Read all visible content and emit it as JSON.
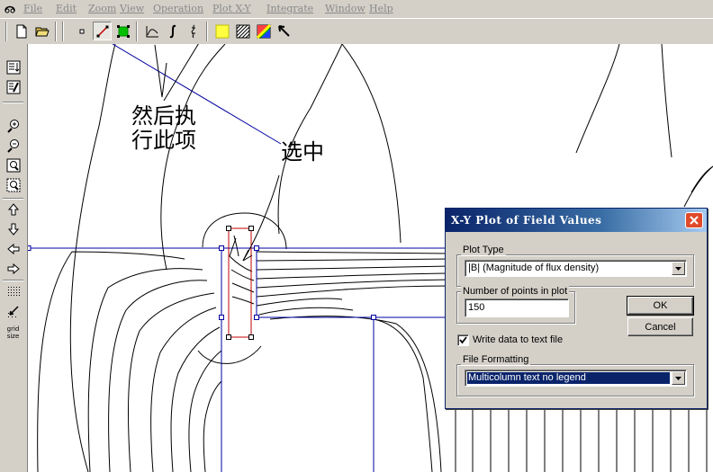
{
  "menubar": {
    "items": [
      "File",
      "Edit",
      "Zoom",
      "View",
      "Operation",
      "Plot X-Y",
      "Integrate",
      "Window",
      "Help"
    ]
  },
  "toolbar": {
    "buttons": [
      "new-file",
      "open-file",
      "point-mode",
      "contour-mode",
      "area-mode",
      "plot-xy",
      "integrate",
      "line-integral",
      "show-density",
      "show-vectors",
      "greyscale",
      "color-map",
      "select-pointer"
    ]
  },
  "annotations": {
    "line1": "然后执",
    "line2": "行此项",
    "select_label": "选中"
  },
  "left_toolbar": {
    "grid_label_1": "grid",
    "grid_label_2": "size"
  },
  "dialog": {
    "title": "X-Y Plot of Field Values",
    "plot_type_label": "Plot Type",
    "plot_type_value": "|B|      (Magnitude of flux density)",
    "points_label": "Number of points in plot",
    "points_value": "150",
    "ok_label": "OK",
    "cancel_label": "Cancel",
    "write_checkbox_label": "Write  data to text file",
    "write_checked": true,
    "file_formatting_label": "File Formatting",
    "file_formatting_value": "Multicolumn text no legend"
  }
}
